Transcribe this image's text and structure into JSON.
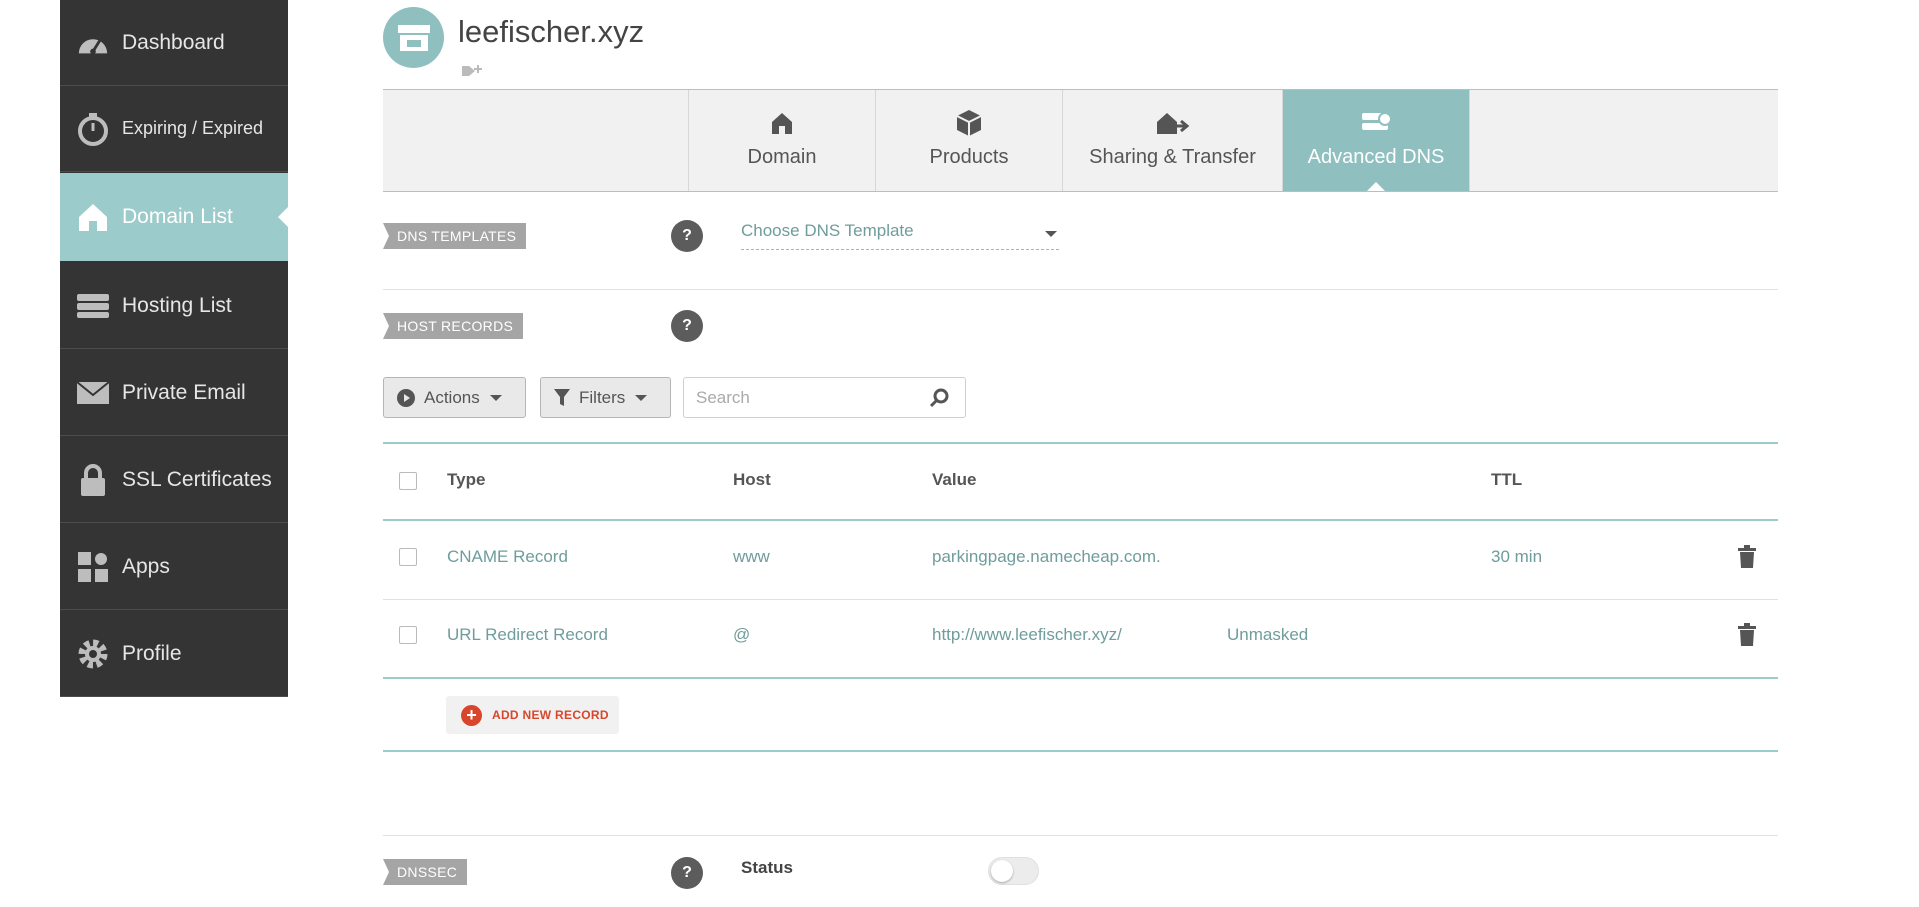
{
  "sidebar": {
    "items": [
      {
        "label": "Dashboard",
        "icon": "speedometer-icon"
      },
      {
        "label": "Expiring / Expired",
        "icon": "stopwatch-icon"
      },
      {
        "label": "Domain List",
        "icon": "home-icon",
        "active": true
      },
      {
        "label": "Hosting List",
        "icon": "server-icon"
      },
      {
        "label": "Private Email",
        "icon": "envelope-icon"
      },
      {
        "label": "SSL Certificates",
        "icon": "lock-icon"
      },
      {
        "label": "Apps",
        "icon": "apps-grid-icon"
      },
      {
        "label": "Profile",
        "icon": "gear-icon"
      }
    ]
  },
  "header": {
    "domain": "leefischer.xyz"
  },
  "tabs": [
    {
      "label": "Domain",
      "icon": "home-icon"
    },
    {
      "label": "Products",
      "icon": "box-icon"
    },
    {
      "label": "Sharing & Transfer",
      "icon": "transfer-icon"
    },
    {
      "label": "Advanced DNS",
      "icon": "dns-icon",
      "active": true
    }
  ],
  "dns_templates": {
    "label": "DNS TEMPLATES",
    "select_value": "Choose DNS Template"
  },
  "host_records": {
    "label": "HOST RECORDS",
    "toolbar": {
      "actions": "Actions",
      "filters": "Filters",
      "search_placeholder": "Search"
    },
    "columns": {
      "type": "Type",
      "host": "Host",
      "value": "Value",
      "ttl": "TTL"
    },
    "rows": [
      {
        "type": "CNAME Record",
        "host": "www",
        "value": "parkingpage.namecheap.com.",
        "extra": "",
        "ttl": "30 min"
      },
      {
        "type": "URL Redirect Record",
        "host": "@",
        "value": "http://www.leefischer.xyz/",
        "extra": "Unmasked",
        "ttl": ""
      }
    ],
    "add_new": "ADD NEW RECORD"
  },
  "dnssec": {
    "label": "DNSSEC",
    "status_label": "Status",
    "enabled": false
  },
  "colors": {
    "accent": "#8fbfbf",
    "sidebar_bg": "#343434",
    "danger": "#d9452c"
  }
}
